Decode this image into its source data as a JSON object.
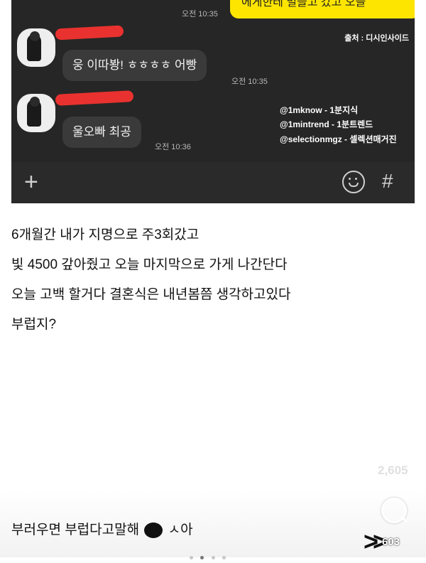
{
  "chat": {
    "top_bubble_text": "에게한테 빌들고 갔고 오늘",
    "top_time": "오전 10:35",
    "source": "출처 : 디시인사이드",
    "messages": [
      {
        "text": "웅 이따봥! ㅎㅎㅎㅎ 어빵",
        "time": "오전 10:35"
      },
      {
        "text": "울오빠 최공",
        "time": "오전 10:36"
      }
    ],
    "watermarks": [
      "@1mknow - 1분지식",
      "@1mintrend - 1분트렌드",
      "@selectionmgz - 셀렉션매거진"
    ],
    "input_bar": {
      "plus_icon": "+",
      "hash_icon": "#"
    }
  },
  "post": {
    "lines": [
      "6개월간 내가 지명으로 주3회갔고",
      "빛 4500 갚아줬고 오늘 마지막으로 가게 나간단다",
      "오늘 고백 할거다 결혼식은 내년봄쯤 생각하고있다",
      "부럽지?"
    ]
  },
  "faint_count": "2,605",
  "comment": {
    "before": "부러우면 부럽다고말해",
    "after": "ㅅ아"
  },
  "nav": {
    "arrows": ">>",
    "count": "603"
  }
}
